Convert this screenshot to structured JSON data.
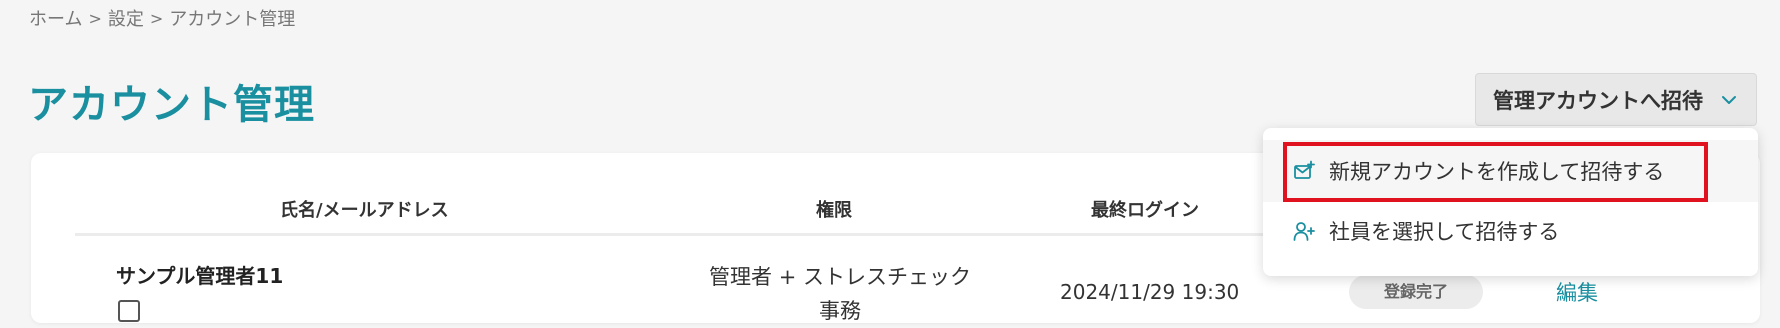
{
  "breadcrumb": {
    "home": "ホーム",
    "settings": "設定",
    "current": "アカウント管理",
    "separator": ">"
  },
  "page": {
    "title": "アカウント管理"
  },
  "invite_button": {
    "label": "管理アカウントへ招待",
    "icon": "chevron-down-icon"
  },
  "invite_menu": {
    "items": [
      {
        "label": "新規アカウントを作成して招待する",
        "icon": "mail-plus-icon"
      },
      {
        "label": "社員を選択して招待する",
        "icon": "user-plus-icon"
      }
    ]
  },
  "table": {
    "headers": {
      "name_email": "氏名/メールアドレス",
      "role": "権限",
      "last_login": "最終ログイン"
    },
    "rows": [
      {
        "name": "サンプル管理者11",
        "role_line1": "管理者 + ストレスチェック",
        "role_line2": "事務",
        "last_login": "2024/11/29 19:30",
        "status": "登録完了",
        "action": "編集"
      }
    ]
  },
  "colors": {
    "accent": "#1a8fa0",
    "highlight": "#e0121f",
    "background": "#f5f5f5"
  }
}
